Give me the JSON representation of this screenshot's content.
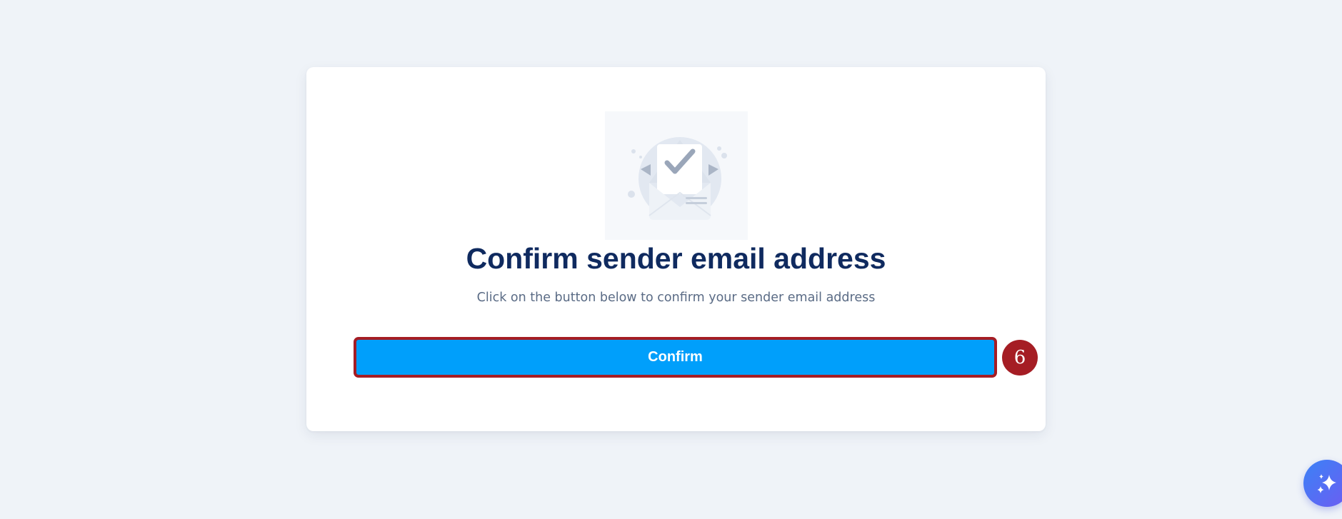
{
  "card": {
    "title": "Confirm sender email address",
    "subtitle": "Click on the button below to confirm your sender email address",
    "confirm_label": "Confirm"
  },
  "annotation": {
    "step_number": "6"
  },
  "icons": {
    "illustration": "envelope-check-icon",
    "fab": "sparkle-icon"
  },
  "colors": {
    "background": "#eff3f8",
    "title": "#0f2a5f",
    "button": "#009ffb",
    "annotation": "#a51d24"
  }
}
